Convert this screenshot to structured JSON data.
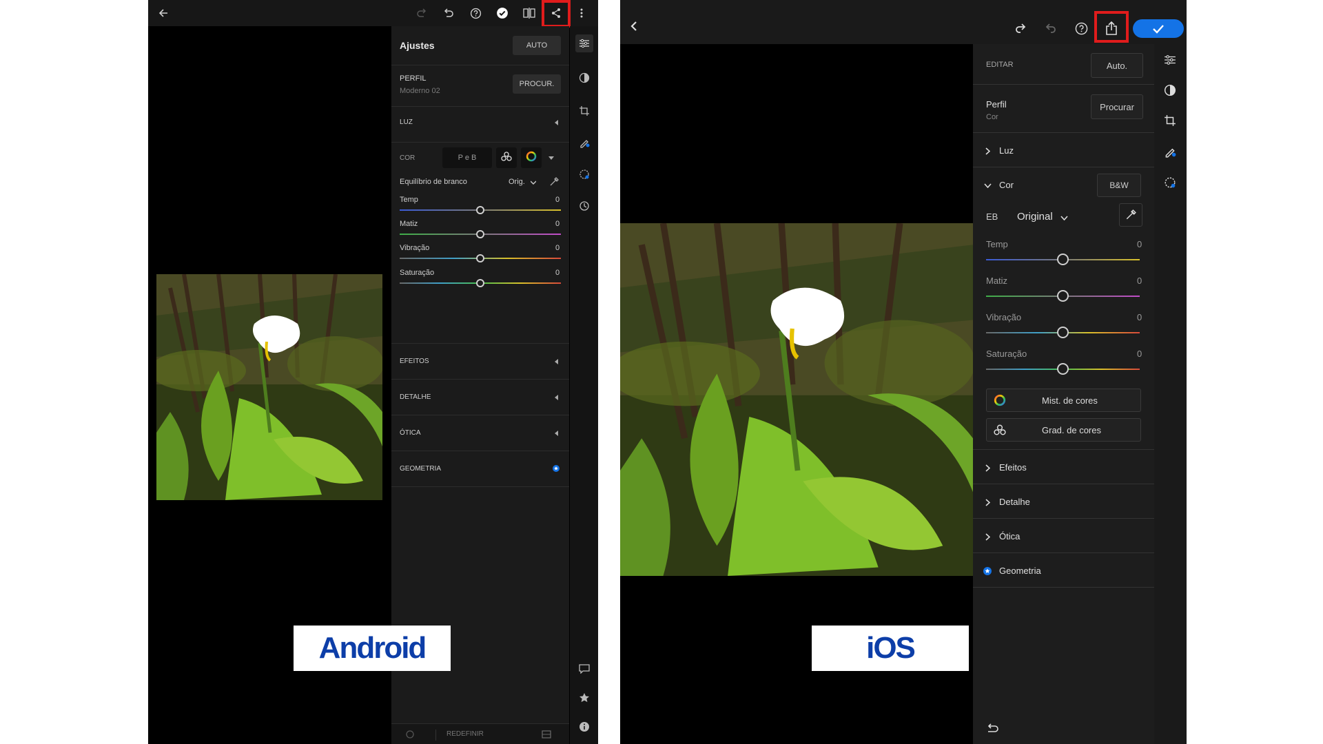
{
  "android": {
    "caption": "Android",
    "panel_title": "Ajustes",
    "auto_label": "AUTO",
    "profile": {
      "label": "PERFIL",
      "value": "Moderno 02",
      "browse": "PROCUR."
    },
    "sections": {
      "luz": "LUZ",
      "cor": "COR",
      "efeitos": "EFEITOS",
      "detalhe": "DETALHE",
      "otica": "ÓTICA",
      "geometria": "GEOMETRIA"
    },
    "bw_label": "P e B",
    "white_balance": {
      "label": "Equilíbrio de branco",
      "value": "Orig."
    },
    "sliders": [
      {
        "label": "Temp",
        "value": "0"
      },
      {
        "label": "Matiz",
        "value": "0"
      },
      {
        "label": "Vibração",
        "value": "0"
      },
      {
        "label": "Saturação",
        "value": "0"
      }
    ],
    "bottom": {
      "reset": "REDEFINIR"
    }
  },
  "ios": {
    "caption": "iOS",
    "edit_label": "EDITAR",
    "auto_label": "Auto.",
    "profile": {
      "label": "Perfil",
      "value": "Cor",
      "browse": "Procurar"
    },
    "sections": {
      "luz": "Luz",
      "cor": "Cor",
      "efeitos": "Efeitos",
      "detalhe": "Detalhe",
      "otica": "Ótica",
      "geometria": "Geometria"
    },
    "bw_label": "B&W",
    "white_balance": {
      "label": "EB",
      "value": "Original"
    },
    "sliders": [
      {
        "label": "Temp",
        "value": "0"
      },
      {
        "label": "Matiz",
        "value": "0"
      },
      {
        "label": "Vibração",
        "value": "0"
      },
      {
        "label": "Saturação",
        "value": "0"
      }
    ],
    "color_mix": "Mist. de cores",
    "color_grading": "Grad. de cores"
  },
  "icons": {
    "back": "arrow-left-icon",
    "redo": "redo-icon",
    "undo": "undo-icon",
    "help": "help-icon",
    "done": "checkmark-icon",
    "compare": "compare-icon",
    "share": "share-icon",
    "more": "more-vertical-icon",
    "adjust": "sliders-icon",
    "presets": "presets-icon",
    "crop": "crop-icon",
    "heal": "heal-icon",
    "masking": "masking-icon",
    "history": "history-icon",
    "comment": "comment-icon",
    "star": "star-icon",
    "info": "info-icon"
  },
  "colors": {
    "highlight": "#e01c1c",
    "ios_accent": "#1473e6",
    "caption_text": "#0d3ea8"
  }
}
